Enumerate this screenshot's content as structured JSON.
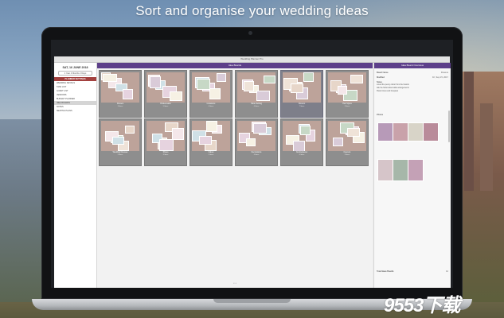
{
  "headline": "Sort and organise your wedding ideas",
  "colors": {
    "accent_purple": "#5d3f8a",
    "planner_red": "#a3413f",
    "card_grey": "#8e8e8e",
    "moodboard_pink": "#bda39a"
  },
  "app": {
    "window_title": "Wedding Planner Pro",
    "sidebar": {
      "date": "SAT, 16 JUNE 2018",
      "countdown": "1 Year 4 Months 2 Days",
      "planner_label": "PLANNER SETTINGS",
      "items": [
        {
          "label": "WEDDING DETAILS",
          "active": false
        },
        {
          "label": "TASK LIST",
          "active": false
        },
        {
          "label": "GUEST LIST",
          "active": false
        },
        {
          "label": "VENDORS",
          "active": false
        },
        {
          "label": "BUDGET PLANNER",
          "active": false
        },
        {
          "label": "IDEA BOARDS",
          "active": true
        },
        {
          "label": "NOTES",
          "active": false
        },
        {
          "label": "SEATING PLANS",
          "active": false
        }
      ]
    },
    "board": {
      "title": "Idea Boards",
      "footer": "• • •",
      "cards": [
        {
          "caption": "Flowers",
          "sub": "3 Ideas",
          "selected": false
        },
        {
          "caption": "Bridesmaids",
          "sub": "5 Ideas",
          "selected": false
        },
        {
          "caption": "Invitations",
          "sub": "6 Ideas",
          "selected": false
        },
        {
          "caption": "Table Setting",
          "sub": "4 Ideas",
          "selected": false
        },
        {
          "caption": "Flowers",
          "sub": "7 Ideas",
          "selected": true
        },
        {
          "caption": "Hair Styles",
          "sub": "3 Ideas",
          "selected": false
        },
        {
          "caption": "Wedding Dresses",
          "sub": "5 Ideas",
          "selected": false
        },
        {
          "caption": "Shoes",
          "sub": "4 Ideas",
          "selected": false
        },
        {
          "caption": "Cakes",
          "sub": "5 Ideas",
          "selected": false
        },
        {
          "caption": "Decorations",
          "sub": "4 Ideas",
          "selected": false
        },
        {
          "caption": "Centrepieces",
          "sub": "6 Ideas",
          "selected": false
        },
        {
          "caption": "Favours",
          "sub": "3 Ideas",
          "selected": false
        }
      ]
    },
    "inspector": {
      "title": "Idea Board Overview",
      "board_name_label": "Board Name",
      "board_name_value": "Flowers",
      "modified_label": "Modified",
      "modified_value": "Fri, Sep 15, 2017",
      "notes_label": "Notes",
      "notes": [
        "Loved the peony colour from the boards",
        "Ask the florist about table arrangements",
        "Pastel roses and bouquets"
      ],
      "photos_label": "Photos",
      "total_label": "Total Ideas Boards",
      "total_value": "12"
    }
  },
  "watermark": "9553下载"
}
